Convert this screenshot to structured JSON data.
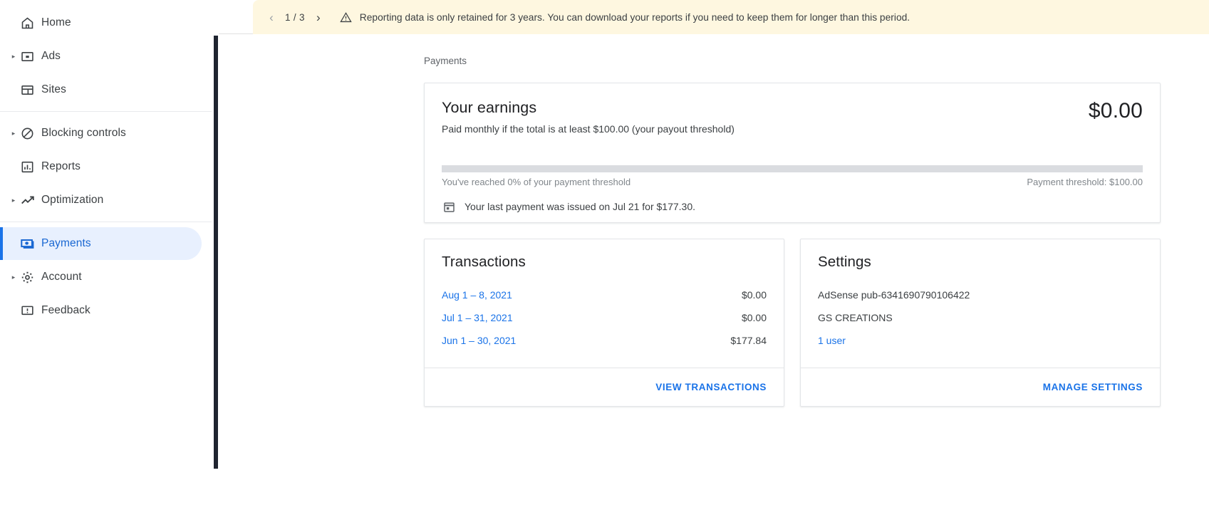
{
  "colors": {
    "accent": "#1a73e8",
    "active_nav_bg": "#e8f0fe",
    "active_nav_text": "#1967d2",
    "banner_bg": "#fef7e0",
    "progress_track": "#dadce0",
    "text_primary": "#202124",
    "text_secondary": "#5f6368"
  },
  "sidebar": {
    "groups": [
      {
        "items": [
          {
            "label": "Home",
            "icon": "home-icon",
            "expandable": false,
            "active": false
          },
          {
            "label": "Ads",
            "icon": "ads-icon",
            "expandable": true,
            "active": false
          },
          {
            "label": "Sites",
            "icon": "sites-icon",
            "expandable": false,
            "active": false
          }
        ]
      },
      {
        "items": [
          {
            "label": "Blocking controls",
            "icon": "block-icon",
            "expandable": true,
            "active": false
          },
          {
            "label": "Reports",
            "icon": "bar-chart-icon",
            "expandable": false,
            "active": false
          },
          {
            "label": "Optimization",
            "icon": "trending-up-icon",
            "expandable": true,
            "active": false
          }
        ]
      },
      {
        "items": [
          {
            "label": "Payments",
            "icon": "payments-icon",
            "expandable": false,
            "active": true
          },
          {
            "label": "Account",
            "icon": "gear-icon",
            "expandable": true,
            "active": false
          },
          {
            "label": "Feedback",
            "icon": "feedback-icon",
            "expandable": false,
            "active": false
          }
        ]
      }
    ]
  },
  "banner": {
    "page_indicator": "1 / 3",
    "prev_label": "‹",
    "next_label": "›",
    "warning_icon": "warning-triangle-icon",
    "message": "Reporting data is only retained for 3 years. You can download your reports if you need to keep them for longer than this period."
  },
  "breadcrumb": "Payments",
  "earnings": {
    "title": "Your earnings",
    "subtitle": "Paid monthly if the total is at least $100.00 (your payout threshold)",
    "amount": "$0.00",
    "progress_percent": 0,
    "progress_label": "You've reached 0% of your payment threshold",
    "threshold_label": "Payment threshold: $100.00",
    "last_payment_icon": "calendar-icon",
    "last_payment": "Your last payment was issued on Jul 21 for $177.30."
  },
  "transactions": {
    "title": "Transactions",
    "rows": [
      {
        "date": "Aug 1 – 8, 2021",
        "amount": "$0.00"
      },
      {
        "date": "Jul 1 – 31, 2021",
        "amount": "$0.00"
      },
      {
        "date": "Jun 1 – 30, 2021",
        "amount": "$177.84"
      }
    ],
    "action": "VIEW TRANSACTIONS"
  },
  "settings": {
    "title": "Settings",
    "publisher_id": "AdSense pub-6341690790106422",
    "account_name": "GS CREATIONS",
    "users_link": "1 user",
    "action": "MANAGE SETTINGS"
  }
}
